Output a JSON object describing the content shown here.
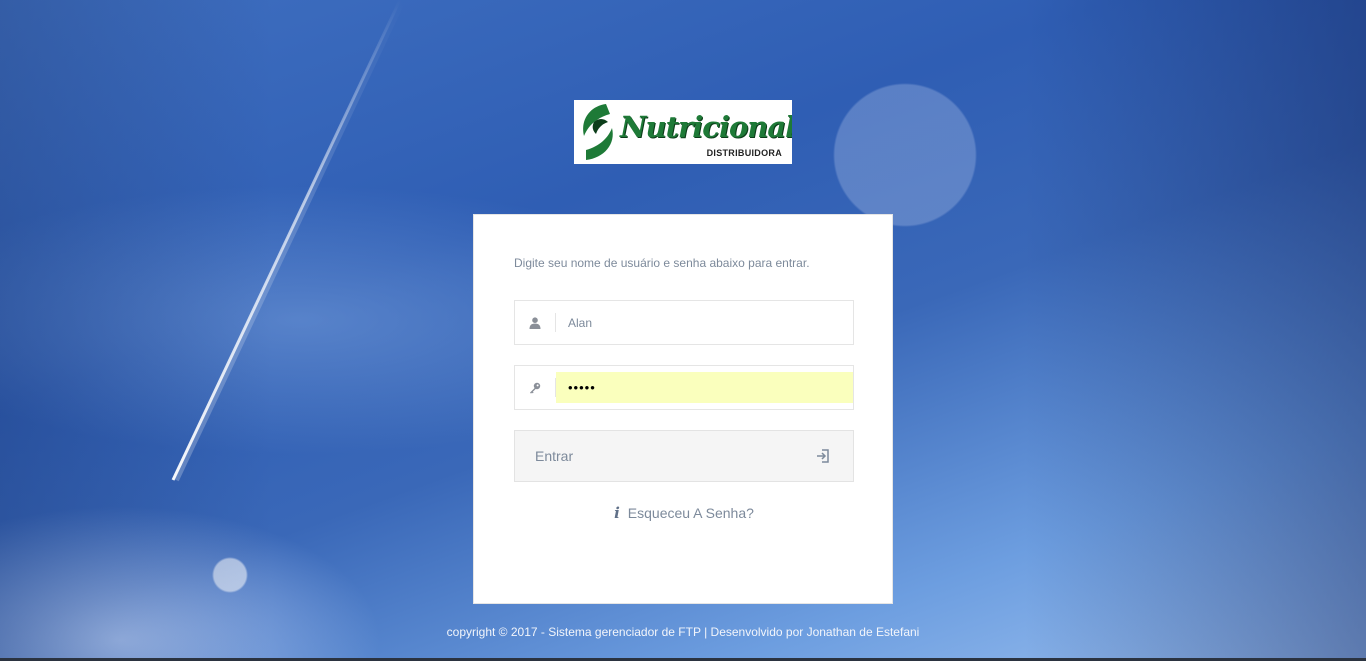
{
  "logo": {
    "name": "Nutricional",
    "subtitle": "DISTRIBUIDORA"
  },
  "login": {
    "instructions": "Digite seu nome de usuário e senha abaixo para entrar.",
    "username": {
      "value": "Alan",
      "icon": "user-icon"
    },
    "password": {
      "value": "•••••",
      "icon": "key-icon"
    },
    "submit_label": "Entrar",
    "submit_icon": "login-icon",
    "forgot_label": "Esqueceu A Senha?",
    "forgot_icon": "info-icon"
  },
  "footer": {
    "text": "copyright © 2017 - Sistema gerenciador de FTP  |  Desenvolvido por Jonathan de Estefani"
  },
  "colors": {
    "logo_green": "#1e7a37",
    "autofill_yellow": "#faffbd",
    "muted_text": "#7d8a9b"
  }
}
